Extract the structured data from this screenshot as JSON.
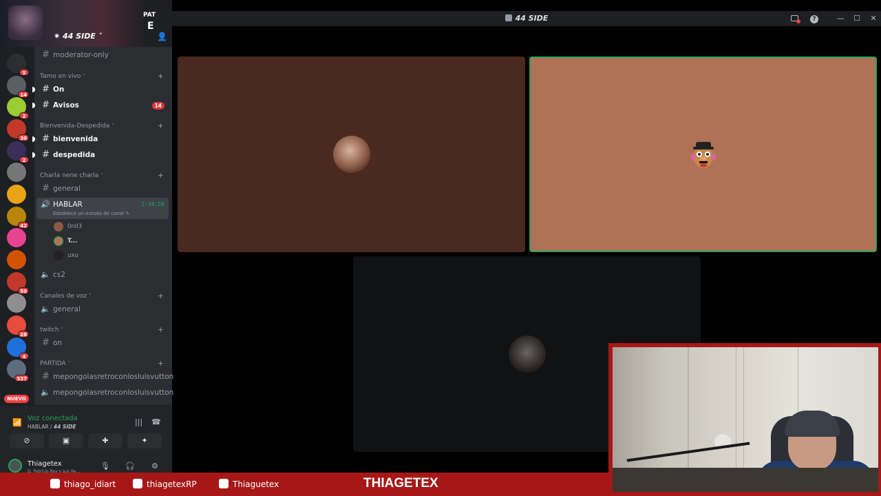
{
  "window": {
    "title": "44 SIDE"
  },
  "server": {
    "name": "44 SIDE",
    "banner_line1": "PAT",
    "banner_line2": "E"
  },
  "guilds": [
    {
      "badge": "5",
      "color": "#2b2d31"
    },
    {
      "badge": "14",
      "color": "#5a5f66"
    },
    {
      "badge": "2",
      "color": "#9acd32"
    },
    {
      "badge": "30",
      "color": "#c0392b"
    },
    {
      "badge": "2",
      "color": "#3b2f5a"
    },
    {
      "badge": "",
      "color": "#777777"
    },
    {
      "badge": "",
      "color": "#e8a317"
    },
    {
      "badge": "42",
      "color": "#b8860b"
    },
    {
      "badge": "",
      "color": "#e84393"
    },
    {
      "badge": "",
      "color": "#d35400"
    },
    {
      "badge": "59",
      "color": "#c0392b"
    },
    {
      "badge": "",
      "color": "#8e8e8e"
    },
    {
      "badge": "28",
      "color": "#e74c3c"
    },
    {
      "badge": "4",
      "color": "#1e6fd9"
    },
    {
      "badge": "537",
      "color": "#5d6d7e"
    }
  ],
  "guild_new_label": "NUEVO",
  "sidebar": {
    "top_channel": "moderator-only",
    "categories": [
      {
        "name": "Tamo en vivo"
      },
      {
        "name": "Bienvenida-Despedida"
      },
      {
        "name": "Charla nene charla"
      },
      {
        "name": "Canales de voz"
      },
      {
        "name": "twitch"
      },
      {
        "name": "PARTIDA"
      }
    ],
    "channels": {
      "on": "On",
      "avisos": "Avisos",
      "avisos_badge": "14",
      "bienvenida": "bienvenida",
      "despedida": "despedida",
      "general_text": "general",
      "hablar": "HABLAR",
      "hablar_timer": "2:34:59",
      "hablar_status": "Establece un estado de canal",
      "cs2": "cs2",
      "general_voice": "general",
      "twitch_on": "on",
      "partida1": "mepongolasretroconlosluisvutton",
      "partida2": "mepongolasretroconlosluisvutton"
    },
    "voice_users": [
      "0nII3",
      "T...",
      "uxu"
    ]
  },
  "voice_panel": {
    "status": "Voz conectada",
    "channel": "HABLAR",
    "server": "44 SIDE"
  },
  "user_panel": {
    "username": "Thiagetex",
    "status_text": "D. Patricio Rey y sus Re..."
  },
  "stream_overlay": {
    "instagram": "thiago_idiart",
    "twitter": "thiagetexRP",
    "youtube": "Thiaguetex",
    "brand": "THIAGETEX"
  },
  "colors": {
    "accent_green": "#23a55a",
    "stream_red": "#a61818",
    "badge_red": "#f23f43"
  }
}
